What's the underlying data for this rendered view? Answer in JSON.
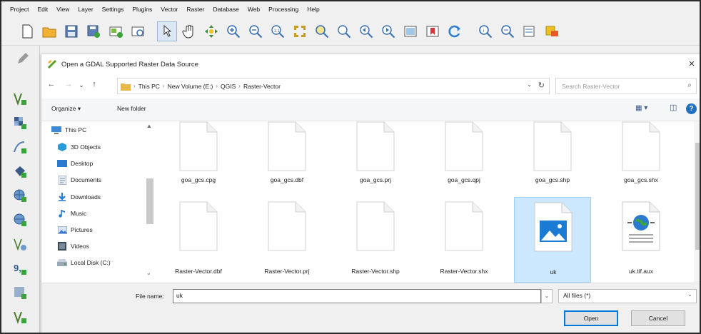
{
  "menubar": {
    "items": [
      "Project",
      "Edit",
      "View",
      "Layer",
      "Settings",
      "Plugins",
      "Vector",
      "Raster",
      "Database",
      "Web",
      "Processing",
      "Help"
    ]
  },
  "toolbar": {
    "icons": [
      "new-project-icon",
      "open-project-icon",
      "save-project-icon",
      "save-as-icon",
      "new-print-layout-icon",
      "layout-manager-icon",
      "identify-icon",
      "pan-icon",
      "pan-to-selection-icon",
      "zoom-in-icon",
      "zoom-out-icon",
      "zoom-native-icon",
      "zoom-full-icon",
      "zoom-layer-icon",
      "zoom-selection-icon",
      "zoom-last-icon",
      "zoom-next-icon",
      "new-map-view-icon",
      "new-bookmark-icon",
      "refresh-icon",
      "identify-features-icon",
      "select-features-icon",
      "deselect-icon",
      "attribute-table-icon"
    ]
  },
  "dialog": {
    "title": "Open a GDAL Supported Raster Data Source",
    "close_symbol": "×",
    "nav": {
      "back": "←",
      "forward": "→",
      "recent": "⌄",
      "up": "↑"
    },
    "breadcrumb": [
      "This PC",
      "New Volume (E:)",
      "QGIS",
      "Raster-Vector"
    ],
    "breadcrumb_sep": "›",
    "address_dropdown": "⌄",
    "refresh_symbol": "↻",
    "search_placeholder": "Search Raster-Vector",
    "search_symbol": "⌕",
    "organize_label": "Organize ▾",
    "new_folder_label": "New folder",
    "view_symbol": "▦ ▾",
    "pane_symbol": "◫",
    "help_symbol": "?",
    "tree": [
      {
        "label": "This PC",
        "icon": "computer-icon"
      },
      {
        "label": "3D Objects",
        "icon": "3d-objects-icon"
      },
      {
        "label": "Desktop",
        "icon": "desktop-icon"
      },
      {
        "label": "Documents",
        "icon": "documents-icon"
      },
      {
        "label": "Downloads",
        "icon": "downloads-icon"
      },
      {
        "label": "Music",
        "icon": "music-icon"
      },
      {
        "label": "Pictures",
        "icon": "pictures-icon"
      },
      {
        "label": "Videos",
        "icon": "videos-icon"
      },
      {
        "label": "Local Disk (C:)",
        "icon": "local-disk-icon"
      }
    ],
    "tree_scroll": {
      "up": "▲",
      "down": "⌄"
    },
    "files": [
      {
        "name": "goa_gcs.cpg",
        "icon": "blank-file-icon",
        "selected": false
      },
      {
        "name": "goa_gcs.dbf",
        "icon": "blank-file-icon",
        "selected": false
      },
      {
        "name": "goa_gcs.prj",
        "icon": "blank-file-icon",
        "selected": false
      },
      {
        "name": "goa_gcs.qpj",
        "icon": "blank-file-icon",
        "selected": false
      },
      {
        "name": "goa_gcs.shp",
        "icon": "blank-file-icon",
        "selected": false
      },
      {
        "name": "goa_gcs.shx",
        "icon": "blank-file-icon",
        "selected": false
      },
      {
        "name": "Raster-Vector.dbf",
        "icon": "blank-file-icon",
        "selected": false
      },
      {
        "name": "Raster-Vector.prj",
        "icon": "blank-file-icon",
        "selected": false
      },
      {
        "name": "Raster-Vector.shp",
        "icon": "blank-file-icon",
        "selected": false
      },
      {
        "name": "Raster-Vector.shx",
        "icon": "blank-file-icon",
        "selected": false
      },
      {
        "name": "uk",
        "icon": "image-file-icon",
        "selected": true
      },
      {
        "name": "uk.tif.aux",
        "icon": "xml-globe-file-icon",
        "selected": false
      }
    ],
    "file_name_label": "File name:",
    "file_name_value": "uk",
    "file_name_dropdown": "⌄",
    "file_type_value": "All files (*)",
    "file_type_chevron": "⌄",
    "open_label": "Open",
    "cancel_label": "Cancel"
  },
  "colors": {
    "accent": "#0078d7",
    "selection_bg": "#cce8ff",
    "selection_border": "#99d1ff",
    "folder": "#e8b84a"
  }
}
